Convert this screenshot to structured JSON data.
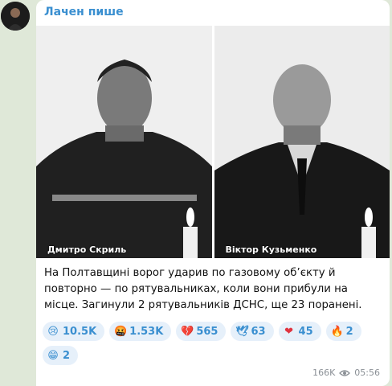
{
  "channel": {
    "name": "Лачен пише"
  },
  "photos": [
    {
      "caption": "Дмитро Скриль"
    },
    {
      "caption": "Віктор Кузьменко"
    }
  ],
  "message": {
    "text": "На Полтавщині ворог ударив по газовому об’єкту й повторно — по рятувальниках, коли вони прибули на місце. Загинули 2 рятувальників ДСНС, ще 23 поранені."
  },
  "reactions": [
    {
      "emoji": "😢",
      "count": "10.5K"
    },
    {
      "emoji": "🤬",
      "count": "1.53K"
    },
    {
      "emoji": "💔",
      "count": "565"
    },
    {
      "emoji": "🕊",
      "count": "63"
    },
    {
      "emoji": "❤",
      "count": "45"
    },
    {
      "emoji": "🔥",
      "count": "2"
    },
    {
      "emoji": "😁",
      "count": "2"
    }
  ],
  "meta": {
    "views": "166K",
    "time": "05:56"
  }
}
